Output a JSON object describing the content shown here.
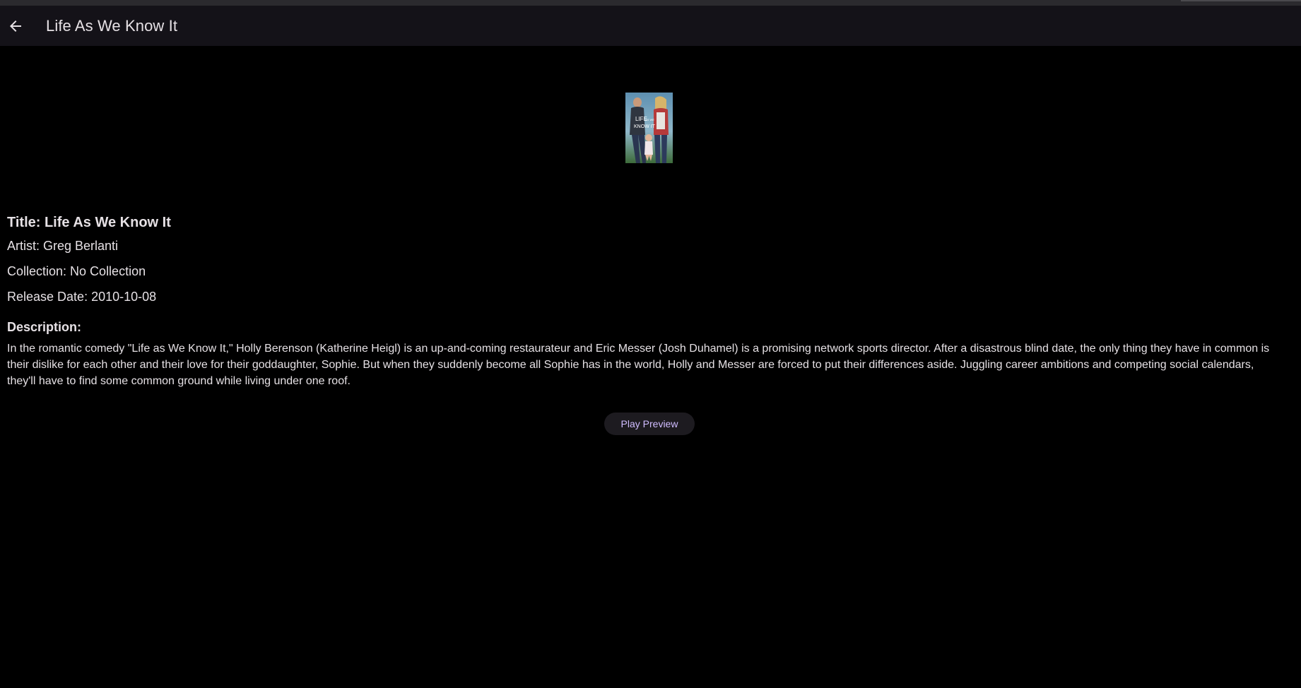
{
  "appbar": {
    "title": "Life As We Know It",
    "back_icon": "arrow-left-icon"
  },
  "poster": {
    "alt": "Life As We Know It poster",
    "text_line1": "LIFE",
    "text_line2": "AS WE",
    "text_line3": "KNOW IT"
  },
  "details": {
    "title": "Title: Life As We Know It",
    "artist": "Artist: Greg Berlanti",
    "collection": "Collection: No Collection",
    "release_date": "Release Date: 2010-10-08",
    "description_heading": "Description:",
    "description": "In the romantic comedy \"Life as We Know It,\" Holly Berenson (Katherine Heigl) is an up-and-coming restaurateur and Eric Messer (Josh Duhamel) is a promising network sports director. After a disastrous blind date, the only thing they have in common is their dislike for each other and their love for their goddaughter, Sophie. But when they suddenly become all Sophie has in the world, Holly and Messer are forced to put their differences aside. Juggling career ambitions and competing social calendars, they'll have to find some common ground while living under one roof."
  },
  "actions": {
    "play_preview_label": "Play Preview"
  },
  "colors": {
    "background": "#000000",
    "appbar": "#141218",
    "text": "#e6e1e5",
    "button_bg": "#1d1b20",
    "button_text": "#d0bcff"
  }
}
